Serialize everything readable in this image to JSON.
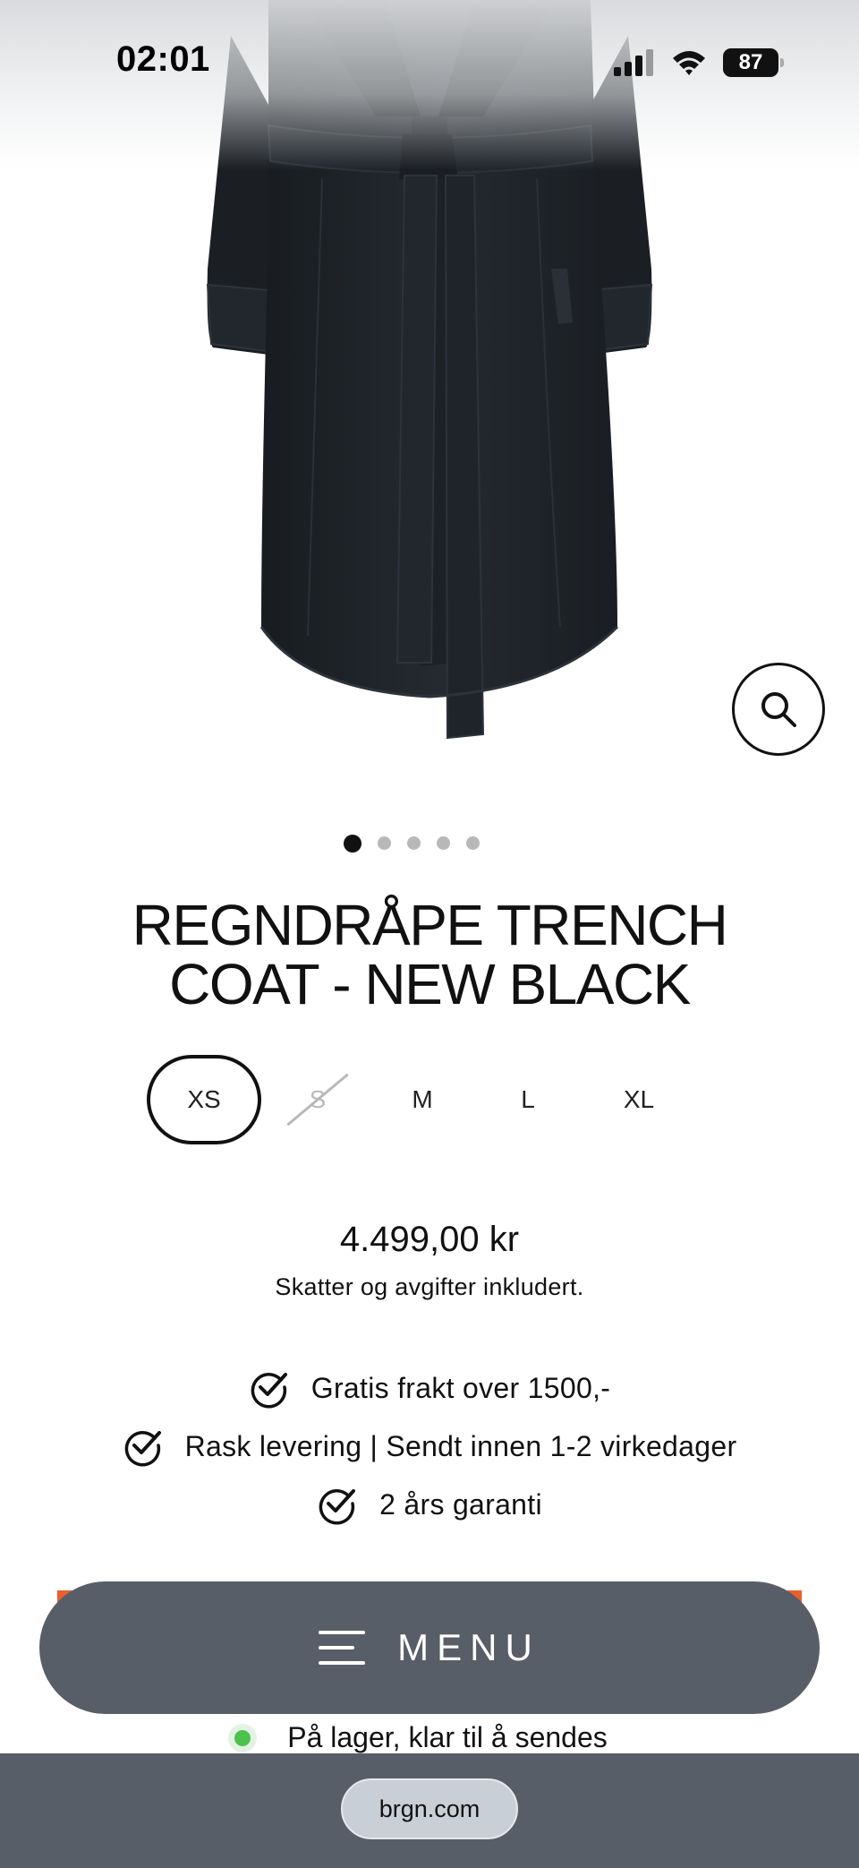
{
  "status_bar": {
    "time": "02:01",
    "battery": "87"
  },
  "product": {
    "title": "REGNDRÅPE TRENCH COAT - NEW BLACK",
    "image_count": 5,
    "active_image": 1,
    "sizes": [
      {
        "label": "XS",
        "selected": true,
        "available": true
      },
      {
        "label": "S",
        "selected": false,
        "available": false
      },
      {
        "label": "M",
        "selected": false,
        "available": true
      },
      {
        "label": "L",
        "selected": false,
        "available": true
      },
      {
        "label": "XL",
        "selected": false,
        "available": true
      }
    ],
    "price": "4.499,00 kr",
    "tax_note": "Skatter og avgifter inkludert."
  },
  "features": [
    "Gratis frakt over 1500,-",
    "Rask levering | Sendt innen 1-2 virkedager",
    "2 års garanti"
  ],
  "menu": {
    "label": "MENU"
  },
  "stock": {
    "text": "På lager, klar til å sendes",
    "status_color": "#4cc24c"
  },
  "browser": {
    "url": "brgn.com"
  },
  "colors": {
    "menu_bg": "#585e68",
    "accent": "#e8612c",
    "coat": "#1d2227"
  },
  "icons": {
    "zoom": "search-icon",
    "feature": "check-circle-icon",
    "menu": "hamburger-icon"
  }
}
